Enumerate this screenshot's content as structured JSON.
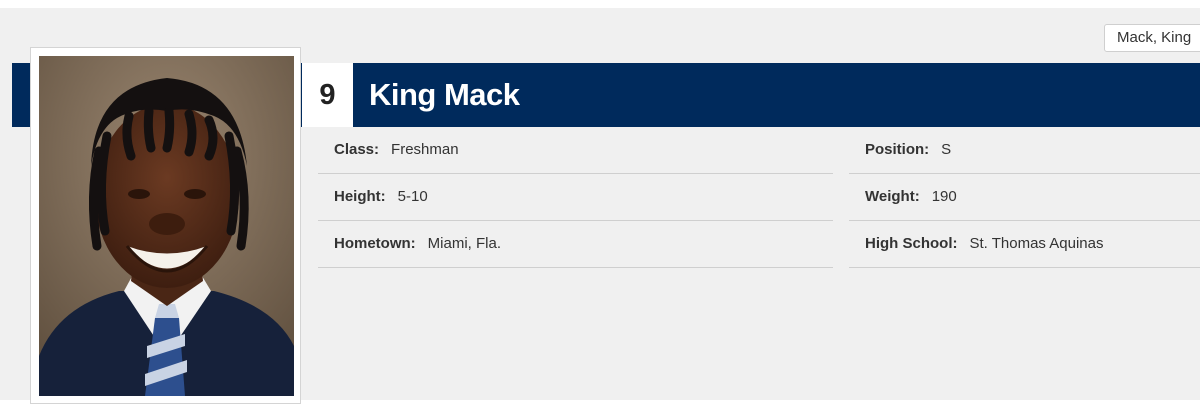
{
  "roster_select": {
    "value": "Mack, King"
  },
  "player": {
    "number": "9",
    "name": "King Mack"
  },
  "details": {
    "class": {
      "label": "Class:",
      "value": "Freshman"
    },
    "position": {
      "label": "Position:",
      "value": "S"
    },
    "height": {
      "label": "Height:",
      "value": "5-10"
    },
    "weight": {
      "label": "Weight:",
      "value": "190"
    },
    "hometown": {
      "label": "Hometown:",
      "value": "Miami, Fla."
    },
    "high_school": {
      "label": "High School:",
      "value": "St. Thomas Aquinas"
    }
  },
  "colors": {
    "header_bar": "#002a5c",
    "page_background": "#f0f0f0"
  }
}
